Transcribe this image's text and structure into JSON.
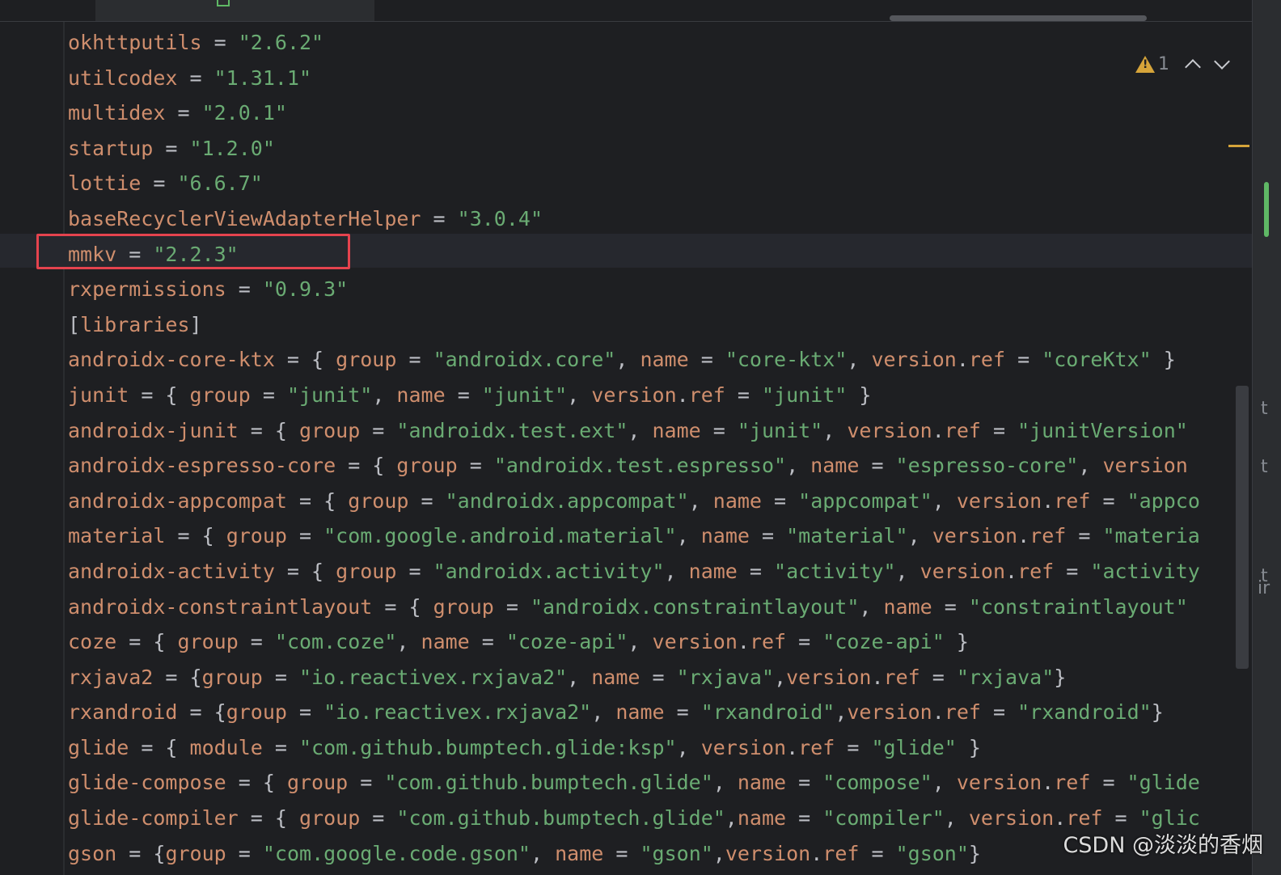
{
  "colors": {
    "background": "#1e1f22",
    "key": "#cf8e6d",
    "string": "#6aab73",
    "punct": "#bcbec4",
    "highlight_box": "#e5434e",
    "warning": "#d6a43a"
  },
  "inspection": {
    "warning_count": "1",
    "icon": "warning-icon"
  },
  "lines": [
    [
      [
        "k",
        "okhttputils"
      ],
      [
        "p",
        " = "
      ],
      [
        "s",
        "\"2.6.2\""
      ]
    ],
    [
      [
        "k",
        "utilcodex"
      ],
      [
        "p",
        " = "
      ],
      [
        "s",
        "\"1.31.1\""
      ]
    ],
    [
      [
        "k",
        "multidex"
      ],
      [
        "p",
        " = "
      ],
      [
        "s",
        "\"2.0.1\""
      ]
    ],
    [
      [
        "k",
        "startup"
      ],
      [
        "p",
        " = "
      ],
      [
        "s",
        "\"1.2.0\""
      ]
    ],
    [
      [
        "k",
        "lottie"
      ],
      [
        "p",
        " = "
      ],
      [
        "s",
        "\"6.6.7\""
      ]
    ],
    [
      [
        "k",
        "baseRecyclerViewAdapterHelper"
      ],
      [
        "p",
        " = "
      ],
      [
        "s",
        "\"3.0.4\""
      ]
    ],
    [
      [
        "k",
        "mmkv"
      ],
      [
        "p",
        " = "
      ],
      [
        "s",
        "\"2.2.3\""
      ]
    ],
    [
      [
        "k",
        "rxpermissions"
      ],
      [
        "p",
        " = "
      ],
      [
        "s",
        "\"0.9.3\""
      ]
    ],
    [
      [
        "p",
        "["
      ],
      [
        "k",
        "libraries"
      ],
      [
        "p",
        "]"
      ]
    ],
    [
      [
        "k",
        "androidx-core-ktx"
      ],
      [
        "p",
        " = { "
      ],
      [
        "k",
        "group"
      ],
      [
        "p",
        " = "
      ],
      [
        "s",
        "\"androidx.core\""
      ],
      [
        "p",
        ", "
      ],
      [
        "k",
        "name"
      ],
      [
        "p",
        " = "
      ],
      [
        "s",
        "\"core-ktx\""
      ],
      [
        "p",
        ", "
      ],
      [
        "k",
        "version"
      ],
      [
        "p",
        "."
      ],
      [
        "k",
        "ref"
      ],
      [
        "p",
        " = "
      ],
      [
        "s",
        "\"coreKtx\""
      ],
      [
        "p",
        " }"
      ]
    ],
    [
      [
        "k",
        "junit"
      ],
      [
        "p",
        " = { "
      ],
      [
        "k",
        "group"
      ],
      [
        "p",
        " = "
      ],
      [
        "s",
        "\"junit\""
      ],
      [
        "p",
        ", "
      ],
      [
        "k",
        "name"
      ],
      [
        "p",
        " = "
      ],
      [
        "s",
        "\"junit\""
      ],
      [
        "p",
        ", "
      ],
      [
        "k",
        "version"
      ],
      [
        "p",
        "."
      ],
      [
        "k",
        "ref"
      ],
      [
        "p",
        " = "
      ],
      [
        "s",
        "\"junit\""
      ],
      [
        "p",
        " }"
      ]
    ],
    [
      [
        "k",
        "androidx-junit"
      ],
      [
        "p",
        " = { "
      ],
      [
        "k",
        "group"
      ],
      [
        "p",
        " = "
      ],
      [
        "s",
        "\"androidx.test.ext\""
      ],
      [
        "p",
        ", "
      ],
      [
        "k",
        "name"
      ],
      [
        "p",
        " = "
      ],
      [
        "s",
        "\"junit\""
      ],
      [
        "p",
        ", "
      ],
      [
        "k",
        "version"
      ],
      [
        "p",
        "."
      ],
      [
        "k",
        "ref"
      ],
      [
        "p",
        " = "
      ],
      [
        "s",
        "\"junitVersion\""
      ]
    ],
    [
      [
        "k",
        "androidx-espresso-core"
      ],
      [
        "p",
        " = { "
      ],
      [
        "k",
        "group"
      ],
      [
        "p",
        " = "
      ],
      [
        "s",
        "\"androidx.test.espresso\""
      ],
      [
        "p",
        ", "
      ],
      [
        "k",
        "name"
      ],
      [
        "p",
        " = "
      ],
      [
        "s",
        "\"espresso-core\""
      ],
      [
        "p",
        ", "
      ],
      [
        "k",
        "version"
      ]
    ],
    [
      [
        "k",
        "androidx-appcompat"
      ],
      [
        "p",
        " = { "
      ],
      [
        "k",
        "group"
      ],
      [
        "p",
        " = "
      ],
      [
        "s",
        "\"androidx.appcompat\""
      ],
      [
        "p",
        ", "
      ],
      [
        "k",
        "name"
      ],
      [
        "p",
        " = "
      ],
      [
        "s",
        "\"appcompat\""
      ],
      [
        "p",
        ", "
      ],
      [
        "k",
        "version"
      ],
      [
        "p",
        "."
      ],
      [
        "k",
        "ref"
      ],
      [
        "p",
        " = "
      ],
      [
        "s",
        "\"appco"
      ]
    ],
    [
      [
        "k",
        "material"
      ],
      [
        "p",
        " = { "
      ],
      [
        "k",
        "group"
      ],
      [
        "p",
        " = "
      ],
      [
        "s",
        "\"com.google.android.material\""
      ],
      [
        "p",
        ", "
      ],
      [
        "k",
        "name"
      ],
      [
        "p",
        " = "
      ],
      [
        "s",
        "\"material\""
      ],
      [
        "p",
        ", "
      ],
      [
        "k",
        "version"
      ],
      [
        "p",
        "."
      ],
      [
        "k",
        "ref"
      ],
      [
        "p",
        " = "
      ],
      [
        "s",
        "\"materia"
      ]
    ],
    [
      [
        "k",
        "androidx-activity"
      ],
      [
        "p",
        " = { "
      ],
      [
        "k",
        "group"
      ],
      [
        "p",
        " = "
      ],
      [
        "s",
        "\"androidx.activity\""
      ],
      [
        "p",
        ", "
      ],
      [
        "k",
        "name"
      ],
      [
        "p",
        " = "
      ],
      [
        "s",
        "\"activity\""
      ],
      [
        "p",
        ", "
      ],
      [
        "k",
        "version"
      ],
      [
        "p",
        "."
      ],
      [
        "k",
        "ref"
      ],
      [
        "p",
        " = "
      ],
      [
        "s",
        "\"activity"
      ]
    ],
    [
      [
        "k",
        "androidx-constraintlayout"
      ],
      [
        "p",
        " = { "
      ],
      [
        "k",
        "group"
      ],
      [
        "p",
        " = "
      ],
      [
        "s",
        "\"androidx.constraintlayout\""
      ],
      [
        "p",
        ", "
      ],
      [
        "k",
        "name"
      ],
      [
        "p",
        " = "
      ],
      [
        "s",
        "\"constraintlayout\""
      ]
    ],
    [
      [
        "k",
        "coze"
      ],
      [
        "p",
        " = { "
      ],
      [
        "k",
        "group"
      ],
      [
        "p",
        " = "
      ],
      [
        "s",
        "\"com.coze\""
      ],
      [
        "p",
        ", "
      ],
      [
        "k",
        "name"
      ],
      [
        "p",
        " = "
      ],
      [
        "s",
        "\"coze-api\""
      ],
      [
        "p",
        ", "
      ],
      [
        "k",
        "version"
      ],
      [
        "p",
        "."
      ],
      [
        "k",
        "ref"
      ],
      [
        "p",
        " = "
      ],
      [
        "s",
        "\"coze-api\""
      ],
      [
        "p",
        " }"
      ]
    ],
    [
      [
        "k",
        "rxjava2"
      ],
      [
        "p",
        " = {"
      ],
      [
        "k",
        "group"
      ],
      [
        "p",
        " = "
      ],
      [
        "s",
        "\"io.reactivex.rxjava2\""
      ],
      [
        "p",
        ", "
      ],
      [
        "k",
        "name"
      ],
      [
        "p",
        " = "
      ],
      [
        "s",
        "\"rxjava\""
      ],
      [
        "p",
        ","
      ],
      [
        "k",
        "version"
      ],
      [
        "p",
        "."
      ],
      [
        "k",
        "ref"
      ],
      [
        "p",
        " = "
      ],
      [
        "s",
        "\"rxjava\""
      ],
      [
        "p",
        "}"
      ]
    ],
    [
      [
        "k",
        "rxandroid"
      ],
      [
        "p",
        " = {"
      ],
      [
        "k",
        "group"
      ],
      [
        "p",
        " = "
      ],
      [
        "s",
        "\"io.reactivex.rxjava2\""
      ],
      [
        "p",
        ", "
      ],
      [
        "k",
        "name"
      ],
      [
        "p",
        " = "
      ],
      [
        "s",
        "\"rxandroid\""
      ],
      [
        "p",
        ","
      ],
      [
        "k",
        "version"
      ],
      [
        "p",
        "."
      ],
      [
        "k",
        "ref"
      ],
      [
        "p",
        " = "
      ],
      [
        "s",
        "\"rxandroid\""
      ],
      [
        "p",
        "}"
      ]
    ],
    [
      [
        "k",
        "glide"
      ],
      [
        "p",
        " = { "
      ],
      [
        "k",
        "module"
      ],
      [
        "p",
        " = "
      ],
      [
        "s",
        "\"com.github.bumptech.glide:ksp\""
      ],
      [
        "p",
        ", "
      ],
      [
        "k",
        "version"
      ],
      [
        "p",
        "."
      ],
      [
        "k",
        "ref"
      ],
      [
        "p",
        " = "
      ],
      [
        "s",
        "\"glide\""
      ],
      [
        "p",
        " }"
      ]
    ],
    [
      [
        "k",
        "glide-compose"
      ],
      [
        "p",
        " = { "
      ],
      [
        "k",
        "group"
      ],
      [
        "p",
        " = "
      ],
      [
        "s",
        "\"com.github.bumptech.glide\""
      ],
      [
        "p",
        ", "
      ],
      [
        "k",
        "name"
      ],
      [
        "p",
        " = "
      ],
      [
        "s",
        "\"compose\""
      ],
      [
        "p",
        ", "
      ],
      [
        "k",
        "version"
      ],
      [
        "p",
        "."
      ],
      [
        "k",
        "ref"
      ],
      [
        "p",
        " = "
      ],
      [
        "s",
        "\"glide"
      ]
    ],
    [
      [
        "k",
        "glide-compiler"
      ],
      [
        "p",
        " = { "
      ],
      [
        "k",
        "group"
      ],
      [
        "p",
        " = "
      ],
      [
        "s",
        "\"com.github.bumptech.glide\""
      ],
      [
        "p",
        ","
      ],
      [
        "k",
        "name"
      ],
      [
        "p",
        " = "
      ],
      [
        "s",
        "\"compiler\""
      ],
      [
        "p",
        ", "
      ],
      [
        "k",
        "version"
      ],
      [
        "p",
        "."
      ],
      [
        "k",
        "ref"
      ],
      [
        "p",
        " = "
      ],
      [
        "s",
        "\"glic"
      ]
    ],
    [
      [
        "k",
        "gson"
      ],
      [
        "p",
        " = {"
      ],
      [
        "k",
        "group"
      ],
      [
        "p",
        " = "
      ],
      [
        "s",
        "\"com.google.code.gson\""
      ],
      [
        "p",
        ", "
      ],
      [
        "k",
        "name"
      ],
      [
        "p",
        " = "
      ],
      [
        "s",
        "\"gson\""
      ],
      [
        "p",
        ","
      ],
      [
        "k",
        "version"
      ],
      [
        "p",
        "."
      ],
      [
        "k",
        "ref"
      ],
      [
        "p",
        " = "
      ],
      [
        "s",
        "\"gson\""
      ],
      [
        "p",
        "}"
      ]
    ]
  ],
  "right_pane_glyphs": [
    "t",
    "t",
    "t",
    "ir"
  ],
  "watermark": "CSDN @淡淡的香烟"
}
